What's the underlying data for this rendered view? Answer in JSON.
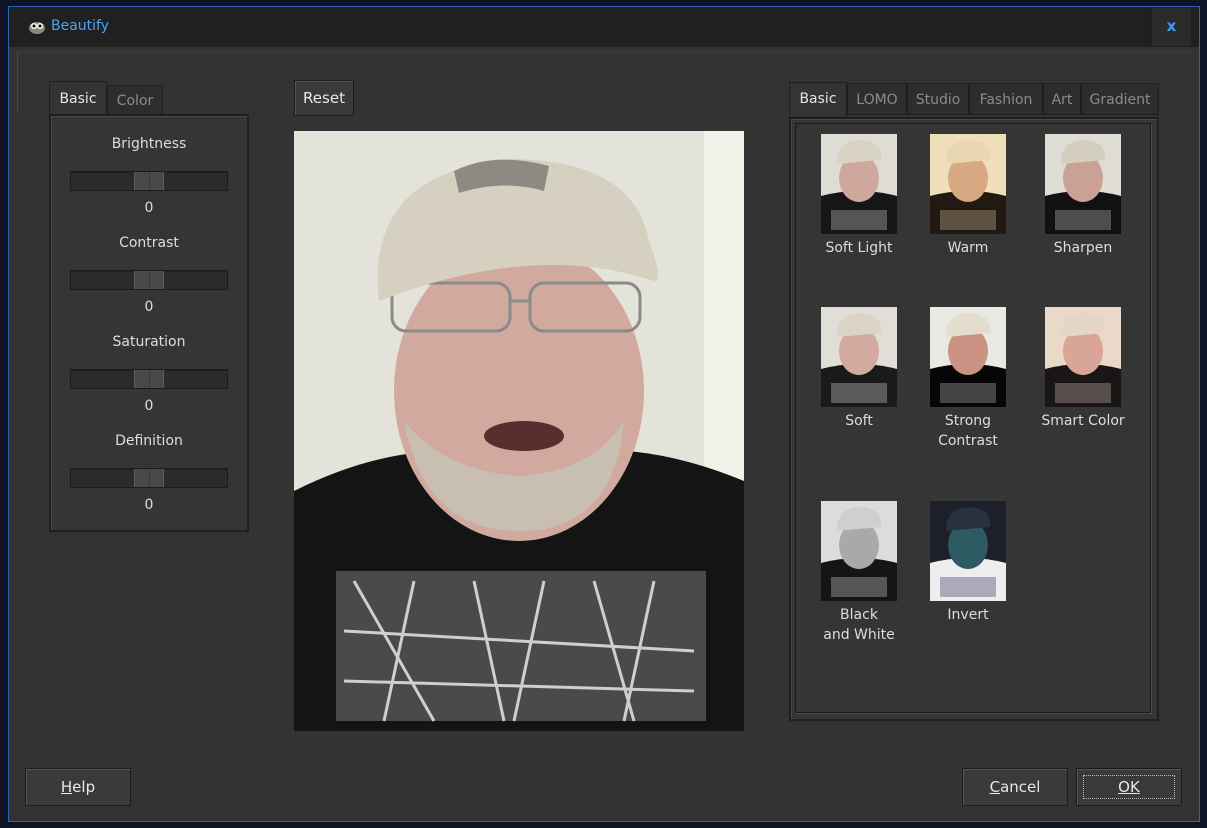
{
  "window": {
    "title": "Beautify",
    "close_glyph": "x"
  },
  "left_tabs": [
    {
      "label": "Basic",
      "active": true
    },
    {
      "label": "Color",
      "active": false
    }
  ],
  "adjustments": [
    {
      "label": "Brightness",
      "value": "0",
      "level": 0.5
    },
    {
      "label": "Contrast",
      "value": "0",
      "level": 0.5
    },
    {
      "label": "Saturation",
      "value": "0",
      "level": 0.5
    },
    {
      "label": "Definition",
      "value": "0",
      "level": 0.5
    }
  ],
  "toolbar": {
    "reset_label": "Reset"
  },
  "right_tabs": [
    {
      "label": "Basic",
      "active": true
    },
    {
      "label": "LOMO",
      "active": false
    },
    {
      "label": "Studio",
      "active": false
    },
    {
      "label": "Fashion",
      "active": false
    },
    {
      "label": "Art",
      "active": false
    },
    {
      "label": "Gradient",
      "active": false
    }
  ],
  "presets": [
    {
      "label": "Soft Light"
    },
    {
      "label": "Warm"
    },
    {
      "label": "Sharpen"
    },
    {
      "label": "Soft"
    },
    {
      "label": "Strong\nContrast"
    },
    {
      "label": "Smart Color"
    },
    {
      "label": "Black\nand White"
    },
    {
      "label": "Invert"
    }
  ],
  "footer": {
    "help_first": "H",
    "help_rest": "elp",
    "cancel_first": "C",
    "cancel_rest": "ancel",
    "ok_label": "OK"
  },
  "colors": {
    "accent": "#3c9bff",
    "title_text": "#4da3f0",
    "window_border": "#2a63b8"
  }
}
